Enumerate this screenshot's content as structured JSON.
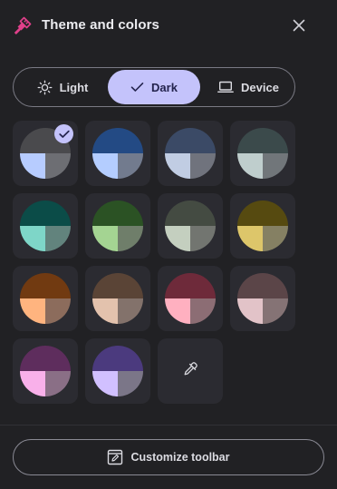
{
  "header": {
    "title": "Theme and colors",
    "icon": "paintbrush-icon",
    "icon_color": "#e0408a",
    "close_icon": "close-icon"
  },
  "mode_toggle": {
    "selected": "Dark",
    "accent": "#c4c3fb",
    "options": [
      {
        "label": "Light",
        "icon": "sun-icon"
      },
      {
        "label": "Dark",
        "icon": "check-icon"
      },
      {
        "label": "Device",
        "icon": "laptop-icon"
      }
    ]
  },
  "color_swatches": {
    "selected_index": 0,
    "items": [
      {
        "top": "#4a4a4d",
        "left": "#b7ccff",
        "right": "#6d6e73"
      },
      {
        "top": "#234a84",
        "left": "#b4cdff",
        "right": "#727b8e"
      },
      {
        "top": "#3b4a66",
        "left": "#c1cde3",
        "right": "#70737d"
      },
      {
        "top": "#3b4a4b",
        "left": "#bfcecd",
        "right": "#71767a"
      },
      {
        "top": "#0b4c48",
        "left": "#7ed6c8",
        "right": "#62837d"
      },
      {
        "top": "#2b5224",
        "left": "#a4d492",
        "right": "#6f7e6a"
      },
      {
        "top": "#444b42",
        "left": "#c4cfbf",
        "right": "#727570"
      },
      {
        "top": "#564a10",
        "left": "#ddc66a",
        "right": "#858063"
      },
      {
        "top": "#713a11",
        "left": "#ffb47f",
        "right": "#8c6c5c"
      },
      {
        "top": "#5a4436",
        "left": "#e3c2ad",
        "right": "#83726b"
      },
      {
        "top": "#6e2a3a",
        "left": "#ffb0c0",
        "right": "#8c6d74"
      },
      {
        "top": "#5b4548",
        "left": "#e2c3c8",
        "right": "#857375"
      },
      {
        "top": "#5e2d5d",
        "left": "#f9b0ea",
        "right": "#8a6f86"
      },
      {
        "top": "#4b3a7e",
        "left": "#d1c0ff",
        "right": "#7b7688"
      }
    ],
    "custom_picker_icon": "eyedropper-icon"
  },
  "footer": {
    "customize_label": "Customize toolbar",
    "customize_icon": "customize-toolbar-icon"
  }
}
